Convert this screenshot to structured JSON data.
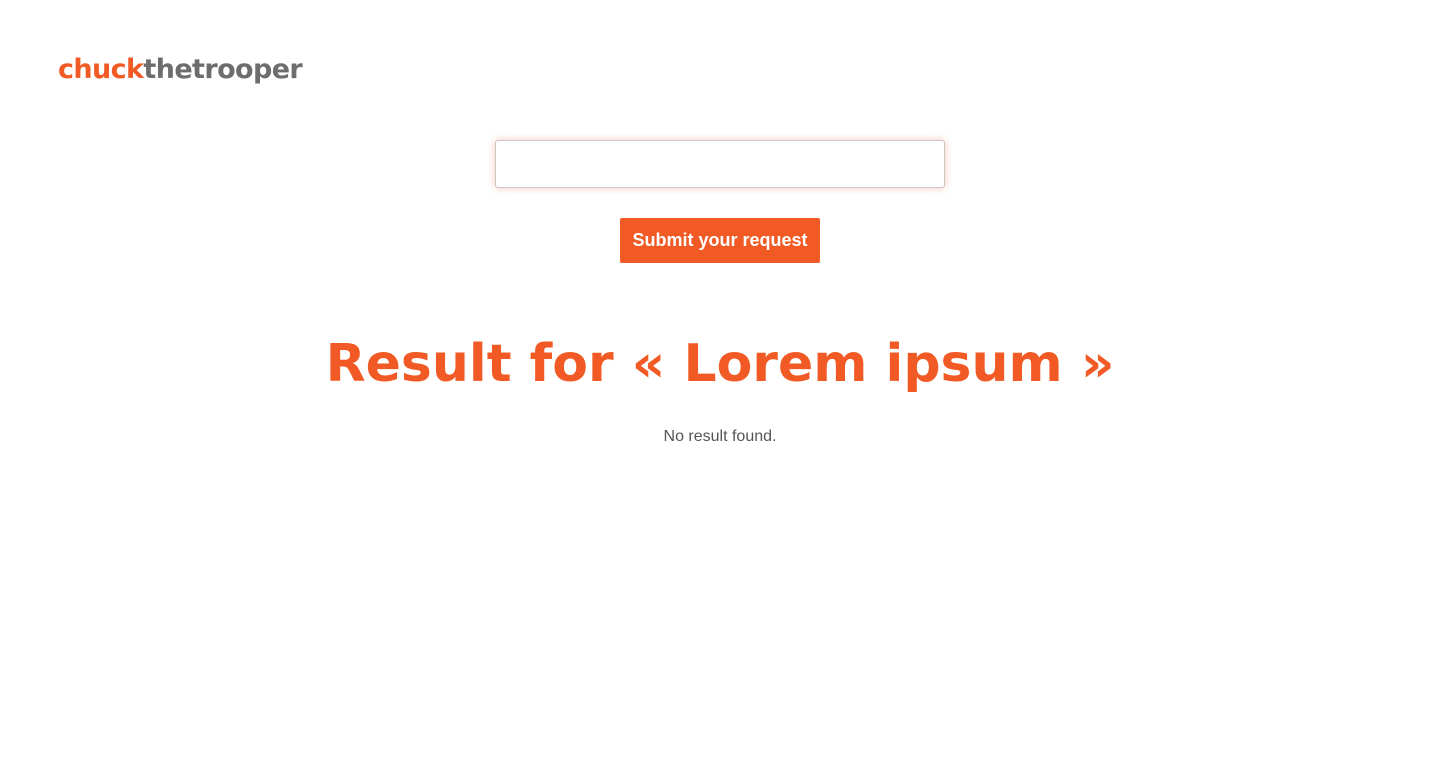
{
  "header": {
    "logo_part1": "chuck",
    "logo_part2": "thetrooper"
  },
  "search": {
    "value": "",
    "placeholder": ""
  },
  "actions": {
    "submit_label": "Submit your request"
  },
  "results": {
    "heading": "Result for «  Lorem ipsum »",
    "empty_message": "No result found."
  },
  "colors": {
    "brand_orange": "#f15a24",
    "logo_gray": "#6d6d6d",
    "text_gray": "#555555",
    "background": "#ffffff"
  }
}
